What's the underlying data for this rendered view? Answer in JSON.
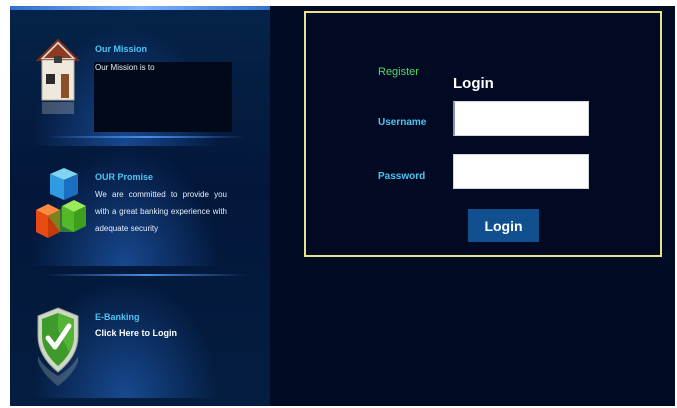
{
  "sidebar": {
    "mission": {
      "title": "Our Mission",
      "text": "Our Mission is to",
      "icon": "house-icon"
    },
    "promise": {
      "title": "OUR Promise",
      "text": "We are committed to provide you with a great banking experience with adequate security",
      "icon": "cubes-icon"
    },
    "ebanking": {
      "title": "E-Banking",
      "link": "Click Here to Login",
      "icon": "shield-check-icon"
    }
  },
  "login": {
    "register_label": "Register",
    "title": "Login",
    "username_label": "Username",
    "password_label": "Password",
    "username_value": "",
    "password_value": "",
    "button_label": "Login"
  },
  "colors": {
    "background": "#020b24",
    "accent_blue": "#4cc4f5",
    "register_green": "#56d56a",
    "login_border": "#e8e28a",
    "button_blue": "#11508f"
  }
}
